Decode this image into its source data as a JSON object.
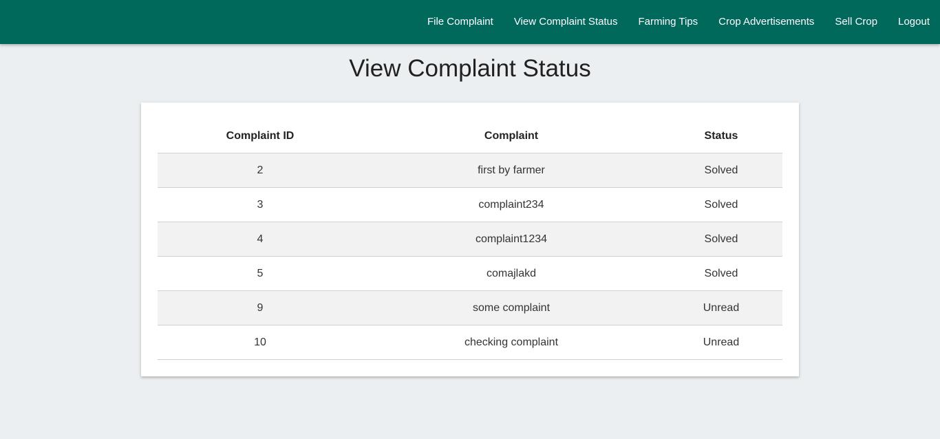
{
  "nav": {
    "items": [
      {
        "label": "File Complaint"
      },
      {
        "label": "View Complaint Status"
      },
      {
        "label": "Farming Tips"
      },
      {
        "label": "Crop Advertisements"
      },
      {
        "label": "Sell Crop"
      },
      {
        "label": "Logout"
      }
    ]
  },
  "page": {
    "title": "View Complaint Status"
  },
  "table": {
    "headers": [
      "Complaint ID",
      "Complaint",
      "Status"
    ],
    "rows": [
      {
        "id": "2",
        "complaint": "first by farmer",
        "status": "Solved"
      },
      {
        "id": "3",
        "complaint": "complaint234",
        "status": "Solved"
      },
      {
        "id": "4",
        "complaint": "complaint1234",
        "status": "Solved"
      },
      {
        "id": "5",
        "complaint": "comajlakd",
        "status": "Solved"
      },
      {
        "id": "9",
        "complaint": "some complaint",
        "status": "Unread"
      },
      {
        "id": "10",
        "complaint": "checking complaint",
        "status": "Unread"
      }
    ]
  },
  "colors": {
    "navbar": "#00695c",
    "background": "#eceff1",
    "row_stripe": "#f2f2f2"
  }
}
